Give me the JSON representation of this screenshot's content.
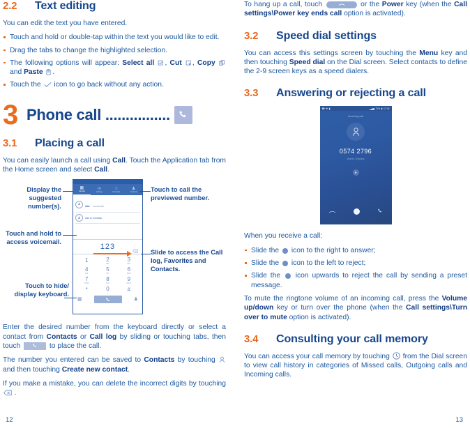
{
  "left": {
    "s22": {
      "number": "2.2",
      "title": "Text editing",
      "intro": "You can edit the text you have entered.",
      "bullets": [
        {
          "prefix": "Touch and hold or double-tap within the text you would like to edit.",
          "type": "plain"
        },
        {
          "prefix": "Drag the tabs to change the highlighted selection.",
          "type": "plain"
        },
        {
          "type": "options",
          "lead": "The following options will appear:",
          "opt1": "Select all",
          "opt2": "Cut",
          "opt3": "Copy",
          "conj": "and",
          "opt4": "Paste",
          "tail": "."
        },
        {
          "type": "check",
          "pre": "Touch the",
          "post": "icon to go back without any action."
        }
      ]
    },
    "chapter": {
      "number": "3",
      "title": "Phone call ................",
      "icon": "phone-handset-icon"
    },
    "s31": {
      "number": "3.1",
      "title": "Placing a call",
      "p1_a": "You can easily launch a call using ",
      "p1_b": "Call",
      "p1_c": ". Touch the Application tab from the Home screen and select ",
      "p1_d": "Call",
      "p1_e": "."
    },
    "figure": {
      "callouts": {
        "tl": "Display the suggested number(s).",
        "tr": "Touch to call the previewed number.",
        "ml": "Touch and hold to access voicemail.",
        "mr_a": "Slide to access the ",
        "mr_b": "Call log",
        "mr_c": ", ",
        "mr_d": "Favorites",
        "mr_e": " and ",
        "mr_f": "Contacts",
        "mr_g": ".",
        "bl": "Touch to hide/ display keyboard."
      },
      "phone": {
        "tabs": [
          {
            "label": "Keypad",
            "glyph": "▦",
            "active": true
          },
          {
            "label": "Call log",
            "glyph": "◷",
            "active": false
          },
          {
            "label": "Favorites",
            "glyph": "☆",
            "active": false
          },
          {
            "label": "Contacts",
            "glyph": "👤",
            "active": false
          }
        ],
        "suggestions": [
          {
            "name": "Abc",
            "number": "1234567891"
          },
          {
            "label": "Add to Contacts"
          }
        ],
        "dialed_number": "123",
        "delete_icon": "backspace-icon",
        "keys": [
          {
            "digit": "1",
            "sub": ""
          },
          {
            "digit": "2",
            "sub": "ABC"
          },
          {
            "digit": "3",
            "sub": "DEF"
          },
          {
            "digit": "4",
            "sub": "GHI"
          },
          {
            "digit": "5",
            "sub": "JKL"
          },
          {
            "digit": "6",
            "sub": "MNO"
          },
          {
            "digit": "7",
            "sub": "PQRS"
          },
          {
            "digit": "8",
            "sub": "TUV"
          },
          {
            "digit": "9",
            "sub": "WXYZ"
          },
          {
            "digit": "*",
            "sub": ""
          },
          {
            "digit": "0",
            "sub": "+"
          },
          {
            "digit": "#",
            "sub": ""
          }
        ],
        "bottom": {
          "keyboard_icon": "keyboard-grid-icon",
          "call_icon": "call-handset-icon",
          "contacts_icon": "contact-person-icon"
        }
      }
    },
    "p_enter_a": "Enter the desired number from the keyboard directly or select a contact from ",
    "p_enter_b": "Contacts",
    "p_enter_c": " or ",
    "p_enter_d": "Call log",
    "p_enter_e": " by sliding or touching tabs, then touch ",
    "p_enter_f": " to place the call.",
    "p_save_a": "The number you entered can be saved to ",
    "p_save_b": "Contacts",
    "p_save_c": " by touching ",
    "p_save_d": " and then touching ",
    "p_save_e": "Create new contact",
    "p_save_f": ".",
    "p_mistake_a": "If you make a mistake, you can delete the incorrect digits by touching ",
    "p_mistake_b": " .",
    "page_number": "12"
  },
  "right": {
    "p_hangup_a": "To hang up a call, touch ",
    "p_hangup_b": " or the ",
    "p_hangup_c": "Power",
    "p_hangup_d": " key (when the ",
    "p_hangup_e": "Call settings\\Power key ends call",
    "p_hangup_f": " option is activated).",
    "s32": {
      "number": "3.2",
      "title": "Speed dial settings",
      "p_a": "You can access this settings screen by touching the ",
      "p_b": "Menu",
      "p_c": " key and then touching ",
      "p_d": "Speed dial",
      "p_e": " on the Dial screen. Select contacts to define the 2-9 screen keys as a speed dialers."
    },
    "s33": {
      "number": "3.3",
      "title": "Answering or rejecting a call",
      "callshot": {
        "statusbar": {
          "left_icons": [
            "call-icon",
            "bluetooth-icon",
            "sim-icon"
          ],
          "signal_icon": "signal-bars-icon",
          "battery_percent": "72%",
          "battery_icon": "battery-icon",
          "time": "17:34"
        },
        "caption": "Incoming call",
        "avatar_icon": "contact-person-icon",
        "number": "0574 2796",
        "subtitle": "Mobile, Zhejiang",
        "slider_icon": "slider-handle-icon",
        "actions": [
          {
            "icon": "reject-handset-icon"
          },
          {
            "icon": "slider-dot-icon"
          },
          {
            "icon": "answer-handset-icon"
          }
        ]
      },
      "intro": "When you receive a call:",
      "bullets": [
        {
          "pre": "Slide the",
          "post": "icon to the right to answer;"
        },
        {
          "pre": "Slide the",
          "post": "icon to the left to reject;"
        },
        {
          "pre": "Slide the",
          "post": "icon upwards to reject the call by sending a preset message."
        }
      ],
      "p_mute_a": "To mute the ringtone volume of an incoming call, press the ",
      "p_mute_b": "Volume up/down",
      "p_mute_c": " key or turn over the phone (when the ",
      "p_mute_d": "Call settings\\Turn over to mute",
      "p_mute_e": " option is activated)."
    },
    "s34": {
      "number": "3.4",
      "title": "Consulting your call memory",
      "p_a": "You can access your call memory by touching ",
      "p_b": " from the Dial screen to view call history in categories of Missed calls, Outgoing calls and Incoming calls.",
      "clock_icon": "clock-icon"
    },
    "page_number": "13"
  },
  "colors": {
    "accent_orange": "#ea6a1e",
    "heading_blue": "#17468c",
    "body_blue": "#1d59a0",
    "phone_ui_blue": "#2b5ea8"
  }
}
